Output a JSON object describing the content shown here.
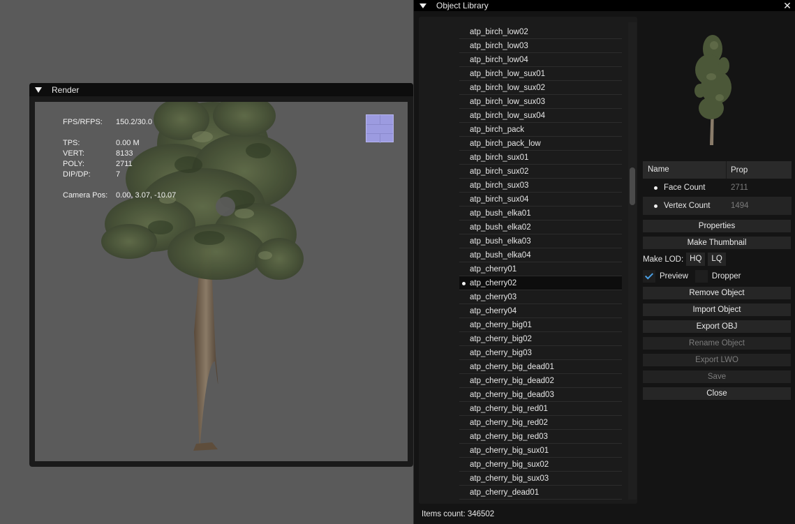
{
  "render": {
    "title": "Render",
    "stats": {
      "fps_label": "FPS/RFPS:",
      "fps_value": "150.2/30.0",
      "tps_label": "TPS:",
      "tps_value": "0.00 M",
      "vert_label": "VERT:",
      "vert_value": "8133",
      "poly_label": "POLY:",
      "poly_value": "2711",
      "dip_label": "DIP/DP:",
      "dip_value": "7",
      "camera_label": "Camera Pos:",
      "camera_value": "0.00, 3.07, -10.07"
    }
  },
  "library": {
    "title": "Object Library",
    "items": [
      "atp_birch_low02",
      "atp_birch_low03",
      "atp_birch_low04",
      "atp_birch_low_sux01",
      "atp_birch_low_sux02",
      "atp_birch_low_sux03",
      "atp_birch_low_sux04",
      "atp_birch_pack",
      "atp_birch_pack_low",
      "atp_birch_sux01",
      "atp_birch_sux02",
      "atp_birch_sux03",
      "atp_birch_sux04",
      "atp_bush_elka01",
      "atp_bush_elka02",
      "atp_bush_elka03",
      "atp_bush_elka04",
      "atp_cherry01",
      "atp_cherry02",
      "atp_cherry03",
      "atp_cherry04",
      "atp_cherry_big01",
      "atp_cherry_big02",
      "atp_cherry_big03",
      "atp_cherry_big_dead01",
      "atp_cherry_big_dead02",
      "atp_cherry_big_dead03",
      "atp_cherry_big_red01",
      "atp_cherry_big_red02",
      "atp_cherry_big_red03",
      "atp_cherry_big_sux01",
      "atp_cherry_big_sux02",
      "atp_cherry_big_sux03",
      "atp_cherry_dead01"
    ],
    "selected_item": "atp_cherry02",
    "items_count": "Items count: 346502",
    "scroll_position": 0.33,
    "properties_table": {
      "header_name": "Name",
      "header_prop": "Prop",
      "rows": [
        {
          "name": "Face Count",
          "value": "2711"
        },
        {
          "name": "Vertex Count",
          "value": "1494"
        }
      ]
    },
    "buttons": {
      "properties": "Properties",
      "make_thumbnail": "Make Thumbnail",
      "make_lod_label": "Make LOD:",
      "hq": "HQ",
      "lq": "LQ",
      "preview": "Preview",
      "dropper": "Dropper",
      "remove_object": "Remove Object",
      "import_object": "Import Object",
      "export_obj": "Export OBJ",
      "rename_object": "Rename Object",
      "export_lwo": "Export LWO",
      "save": "Save",
      "close": "Close"
    },
    "checkboxes": {
      "preview_checked": true,
      "dropper_checked": false
    }
  },
  "colors": {
    "background": "#5a5a5a",
    "window_bg": "#141414",
    "title_bar": "#000000",
    "gizmo": "#9c9be0",
    "check_accent": "#4aa0e6",
    "foliage": "#4e5a3c",
    "trunk": "#6e5c48"
  }
}
